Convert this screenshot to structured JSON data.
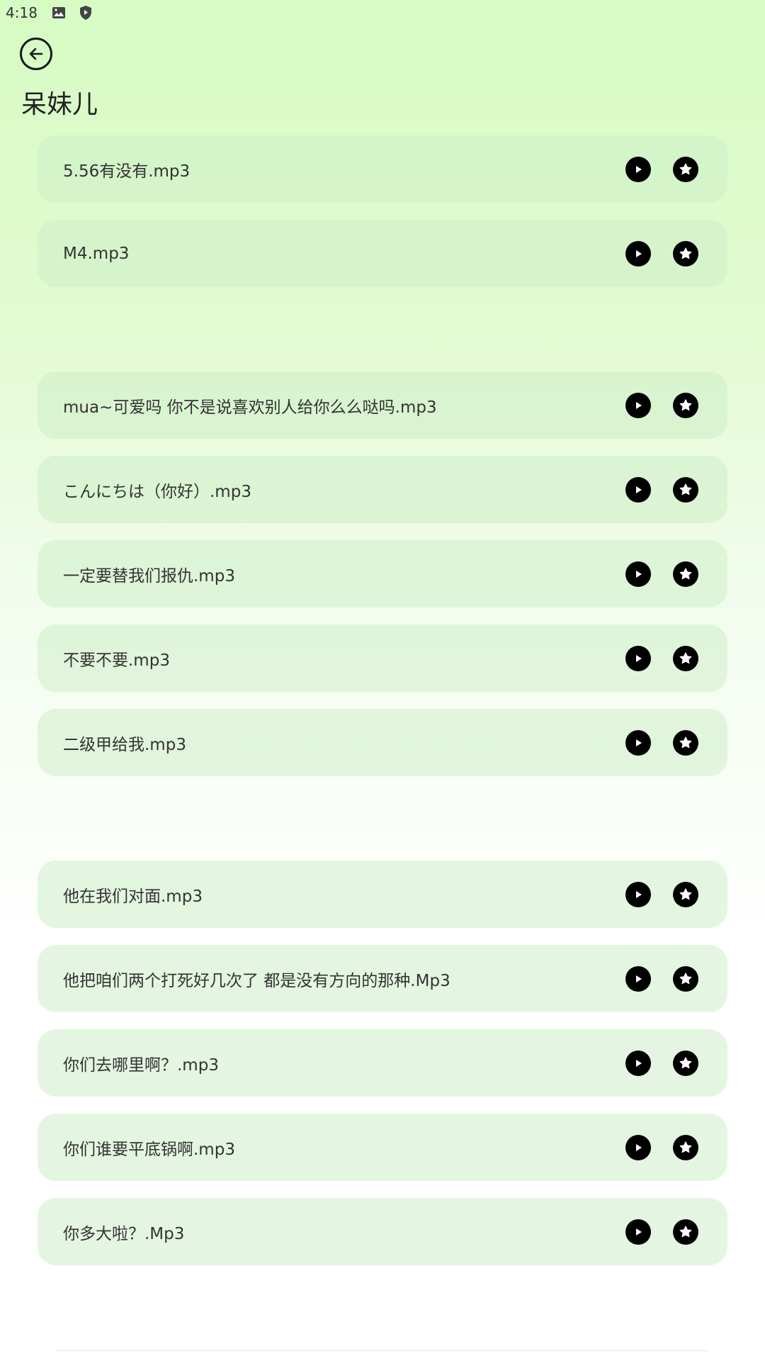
{
  "status_bar": {
    "time": "4:18"
  },
  "header": {
    "title": "呆妹儿"
  },
  "items": [
    {
      "label": "5.56有没有.mp3"
    },
    {
      "label": "M4.mp3"
    },
    {
      "label": "mua~可爱吗 你不是说喜欢别人给你么么哒吗.mp3"
    },
    {
      "label": "こんにちは（你好）.mp3"
    },
    {
      "label": "一定要替我们报仇.mp3"
    },
    {
      "label": "不要不要.mp3"
    },
    {
      "label": "二级甲给我.mp3"
    },
    {
      "label": "他在我们对面.mp3"
    },
    {
      "label": "他把咱们两个打死好几次了 都是没有方向的那种.Mp3"
    },
    {
      "label": "你们去哪里啊？.mp3"
    },
    {
      "label": "你们谁要平底锅啊.mp3"
    },
    {
      "label": "你多大啦？.Mp3"
    }
  ],
  "icons": {
    "back": "arrow-left-circle-icon",
    "play": "play-icon",
    "favorite": "star-icon",
    "status_image": "image-icon",
    "status_shield": "shield-icon"
  }
}
